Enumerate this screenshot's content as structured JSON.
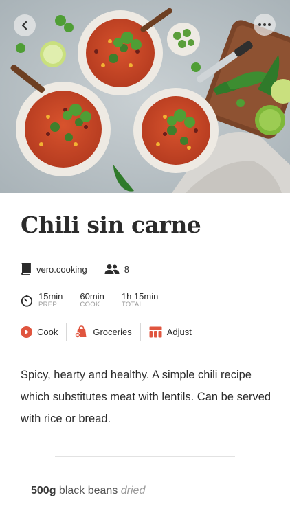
{
  "recipe": {
    "title": "Chili sin carne",
    "source": "vero.cooking",
    "servings": "8",
    "times": [
      {
        "value": "15min",
        "label": "PREP"
      },
      {
        "value": "60min",
        "label": "COOK"
      },
      {
        "value": "1h 15min",
        "label": "TOTAL"
      }
    ],
    "actions": [
      {
        "label": "Cook",
        "icon": "play-circle-icon"
      },
      {
        "label": "Groceries",
        "icon": "grocery-bag-icon"
      },
      {
        "label": "Adjust",
        "icon": "adjust-icon"
      }
    ],
    "description": "Spicy, hearty and healthy. A simple chili recipe which substitutes meat with lentils. Can be served with rice or bread.",
    "ingredients": [
      {
        "quantity": "500g",
        "name": "black beans",
        "note": "dried"
      }
    ]
  },
  "icons": {
    "back": "chevron-left-icon",
    "more": "more-horizontal-icon",
    "source": "book-icon",
    "servings": "people-icon",
    "timer": "timer-icon"
  },
  "colors": {
    "accent": "#e0553f",
    "text": "#2b2b2b",
    "muted": "#9a9a9a"
  }
}
